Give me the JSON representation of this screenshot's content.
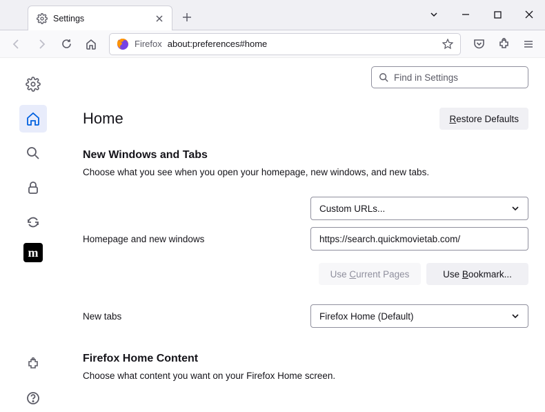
{
  "tab": {
    "title": "Settings"
  },
  "urlbar": {
    "brand": "Firefox",
    "address": "about:preferences#home"
  },
  "search": {
    "placeholder": "Find in Settings"
  },
  "page": {
    "title": "Home",
    "restore_btn": "Restore Defaults",
    "section1": {
      "heading": "New Windows and Tabs",
      "desc": "Choose what you see when you open your homepage, new windows, and new tabs."
    },
    "homepage": {
      "label": "Homepage and new windows",
      "select": "Custom URLs...",
      "value": "https://search.quickmovietab.com/",
      "use_current": "Use Current Pages",
      "use_bookmark": "Use Bookmark..."
    },
    "newtabs": {
      "label": "New tabs",
      "select": "Firefox Home (Default)"
    },
    "section2": {
      "heading": "Firefox Home Content",
      "desc": "Choose what content you want on your Firefox Home screen."
    }
  }
}
